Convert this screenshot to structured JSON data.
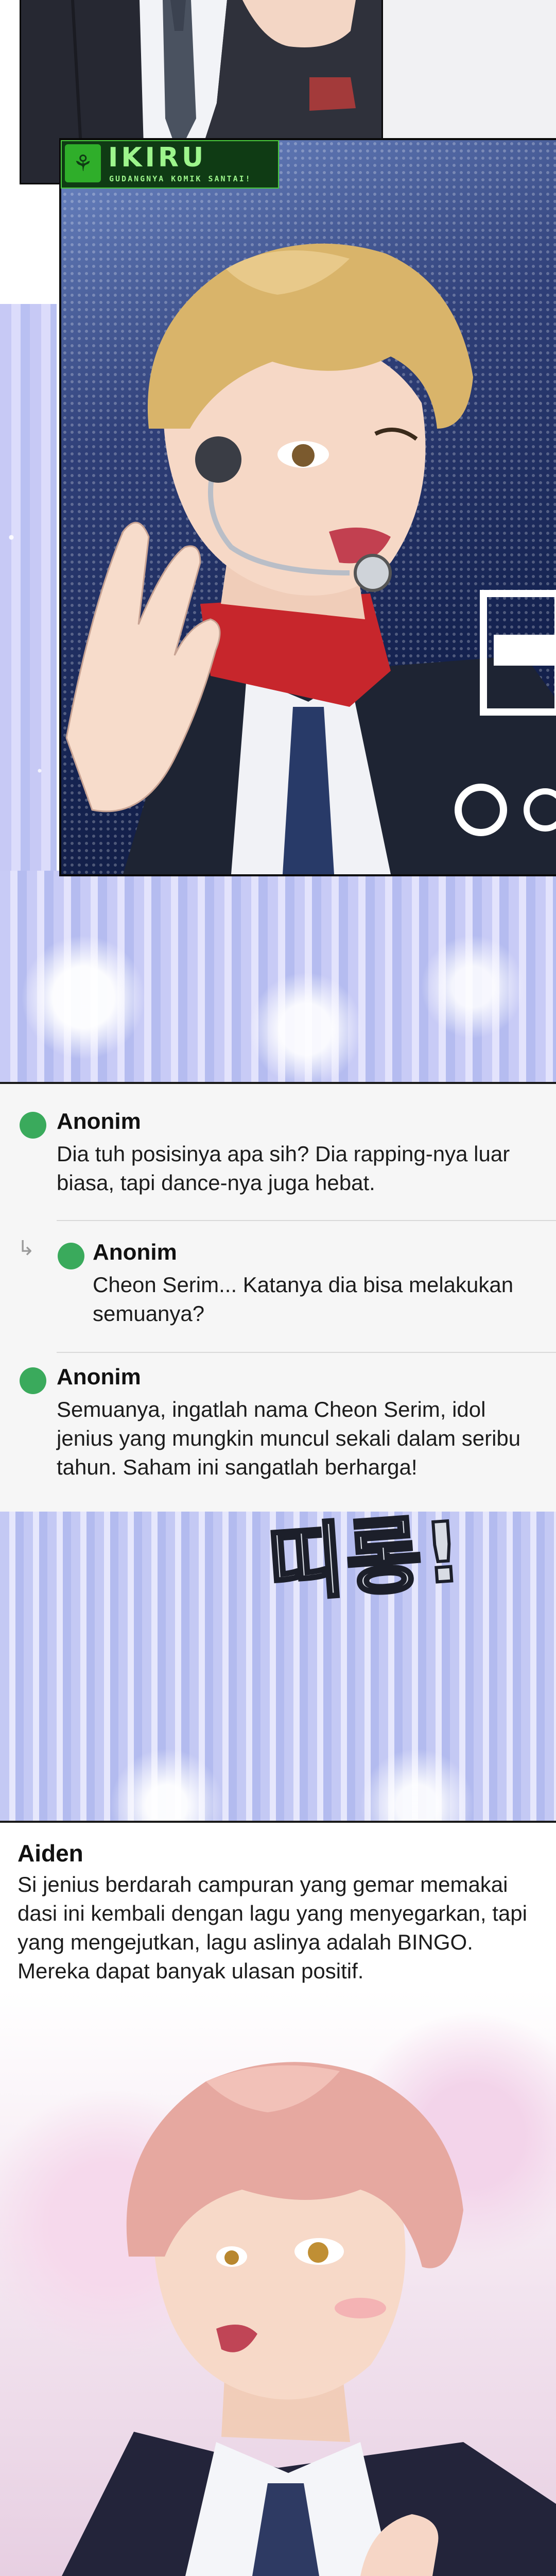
{
  "watermark": {
    "title": "IKIRU",
    "subtitle": "GUDANGNYA KOMIK SANTAI!"
  },
  "comments": [
    {
      "author": "Anonim",
      "text": "Dia tuh posisinya apa sih? Dia rapping-nya luar\nbiasa, tapi dance-nya juga hebat.",
      "reply": false
    },
    {
      "author": "Anonim",
      "text": "Cheon Serim... Katanya dia bisa melakukan\nsemuanya?",
      "reply": true
    },
    {
      "author": "Anonim",
      "text": "Semuanya, ingatlah nama Cheon Serim, idol\njenius yang mungkin muncul sekali dalam seribu\ntahun. Saham ini sangatlah berharga!",
      "reply": false
    }
  ],
  "sfx": "띠롱!",
  "caption": {
    "name": "Aiden",
    "text": "Si jenius berdarah campuran yang gemar memakai dasi ini kembali dengan lagu yang menyegarkan, tapi yang mengejutkan, lagu aslinya adalah BINGO. Mereka dapat banyak ulasan positif."
  },
  "colors": {
    "comment_dot": "#3aaa5c",
    "logo_green": "#9df58c"
  }
}
